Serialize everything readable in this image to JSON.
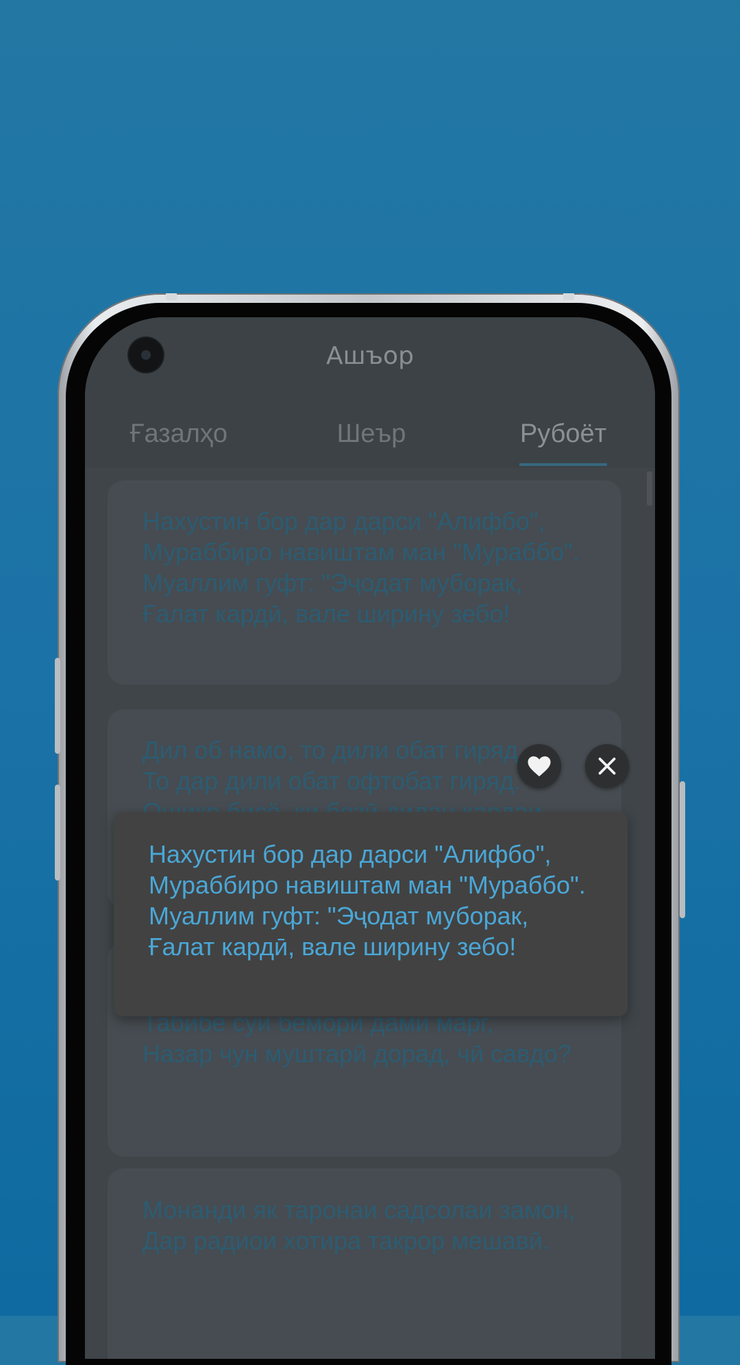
{
  "app": {
    "title": "Ашъор"
  },
  "tabs": [
    {
      "label": "Ғазалҳо",
      "active": false
    },
    {
      "label": "Шеър",
      "active": false
    },
    {
      "label": "Рубоёт",
      "active": true
    }
  ],
  "cards": [
    {
      "text": "Нахустин бор дар дарси \"Алифбо\",\nМураббиро навиштам ман \"Мураббо\".\nМуаллим гуфт: \"Эҷодат муборак,\nҒалат кардӣ, вале ширину зебо!"
    },
    {
      "text": "Дил об намо, то дили обат гиряд,\nТо дар дили обат офтобат гиряд.\nОшиқе бисё, ки бозӣ дилан кардаи"
    },
    {
      "text": "Саросар зебари дорад, чӣ савдо?\nТабибе сӯи бемори дами марг,\nНазар чун муштарӣ дорад, чӣ савдо?"
    },
    {
      "text": "Монанди як таронаи садсолаи замон,\nДар радиои хотира такрор мешавӣ."
    }
  ],
  "popup": {
    "text": "Нахустин бор дар дарси \"Алифбо\",\nМураббиро навиштам ман \"Мураббо\".\nМуаллим гуфт: \"Эҷодат муборак,\nҒалат кардӣ, вале ширину зебо!",
    "accent": "#4aa7d7"
  },
  "icons": {
    "favorite": "heart-icon",
    "close": "close-icon"
  }
}
